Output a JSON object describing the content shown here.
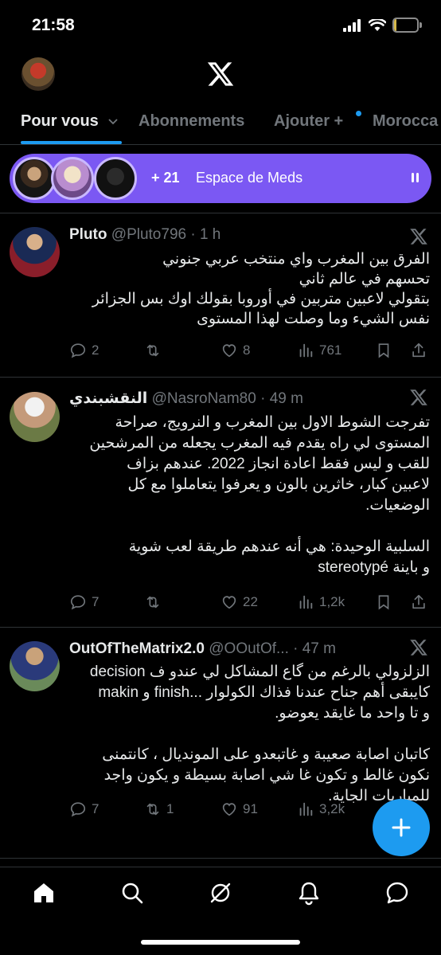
{
  "status": {
    "time": "21:58",
    "battery": "10",
    "battery_level": 0.1
  },
  "tabs": [
    {
      "label": "Pour vous"
    },
    {
      "label": "Abonnements"
    },
    {
      "label": "Ajouter +"
    },
    {
      "label": "Morocca"
    }
  ],
  "space": {
    "count": "+ 21",
    "title": "Espace de Meds"
  },
  "tweets": [
    {
      "name": "Pluto",
      "handle": "@Pluto796 · 1 h",
      "text": "الفرق بين المغرب واي منتخب عربي جنوني\nتحسهم في عالم ثاني\nبتقولي لاعبين متربين في أوروبا بقولك اوك بس الجزائر\nنفس الشيء وما وصلت لهذا المستوى",
      "replies": "2",
      "reposts": "",
      "likes": "8",
      "views": "761"
    },
    {
      "name": "النقشبندي",
      "handle": "@NasroNam80 · 49 m",
      "text": "تفرجت الشوط الاول بين المغرب و النرويج، صراحة\nالمستوى لي راه يقدم فيه المغرب يجعله من المرشحين\nللقب و ليس فقط اعادة انجاز 2022. عندهم بزاف\nلاعبين كبار، خاثرين بالون و يعرفوا يتعاملوا مع كل\nالوضعيات.\n\nالسلبية الوحيدة: هي أنه عندهم طريقة  لعب شوية\nstereotypé و باينة",
      "replies": "7",
      "reposts": "",
      "likes": "22",
      "views": "1,2k"
    },
    {
      "name": "OutOfTheMatrix2.0",
      "handle": "@OOutOf... · 47 m",
      "text": "الزلزولي بالرغم من گاع المشاكل لي عندو ف decision\nmakin و finish... كايبقى أهم جناح عندنا فذاك الكولوار\nو تا واحد ما غايقد يعوضو.\n\nكاتبان اصابة صعيبة و غاتبعدو على المونديال ، كانتمنى\nنكون غالط و تكون غا شي اصابة بسيطة و يكون واجد\nللمباريات الجاية.",
      "replies": "7",
      "reposts": "1",
      "likes": "91",
      "views": "3,2k"
    }
  ],
  "icons": [
    "signal-icon",
    "wifi-icon",
    "x-logo-icon",
    "chevron-down-icon",
    "reply-icon",
    "repost-icon",
    "like-icon",
    "views-icon",
    "bookmark-icon",
    "share-icon",
    "compose-icon",
    "home-icon",
    "search-icon",
    "grok-icon",
    "notifications-icon",
    "messages-icon"
  ],
  "colors": {
    "accent": "#1d9bf0",
    "space": "#7b58f3",
    "muted": "#71767b"
  }
}
